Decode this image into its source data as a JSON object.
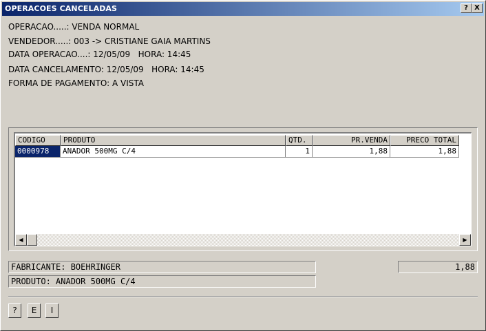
{
  "window": {
    "title": "OPERACOES CANCELADAS",
    "help_label": "?",
    "close_label": "X"
  },
  "info": {
    "operacao": "OPERACAO.....: VENDA NORMAL",
    "vendedor": "VENDEDOR.....: 003 -> CRISTIANE GAIA MARTINS",
    "data_operacao": "DATA OPERACAO....: 12/05/09   HORA: 14:45",
    "data_cancelamento": "DATA CANCELAMENTO: 12/05/09   HORA: 14:45",
    "forma_pagamento": "FORMA DE PAGAMENTO: A VISTA"
  },
  "grid": {
    "columns": [
      "CODIGO",
      "PRODUTO",
      "QTD.",
      "PR.VENDA",
      "PRECO TOTAL"
    ],
    "rows": [
      [
        "0000978",
        "ANADOR 500MG C/4",
        "1",
        "1,88",
        "1,88"
      ]
    ],
    "scroll_left_glyph": "◀",
    "scroll_right_glyph": "▶"
  },
  "footer": {
    "fabricante": "FABRICANTE: BOEHRINGER",
    "produto": "PRODUTO: ANADOR 500MG C/4",
    "total": "1,88"
  },
  "buttons": {
    "help": "?",
    "e": "E",
    "i": "I"
  }
}
